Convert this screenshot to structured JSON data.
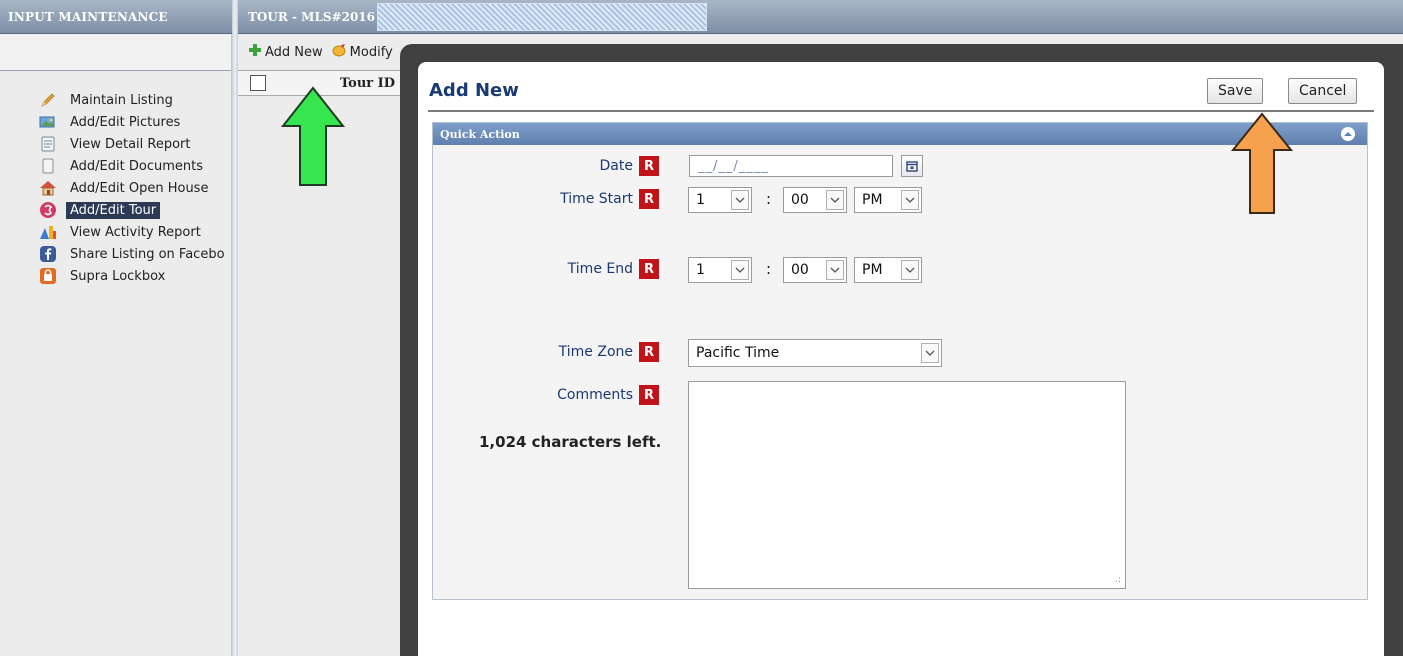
{
  "header": {
    "left_title": "INPUT MAINTENANCE",
    "right_title": "TOUR - MLS#2016"
  },
  "sidebar": {
    "items": [
      {
        "label": "Maintain Listing",
        "icon": "pencil-icon"
      },
      {
        "label": "Add/Edit Pictures",
        "icon": "pictures-icon"
      },
      {
        "label": "View Detail Report",
        "icon": "report-icon"
      },
      {
        "label": "Add/Edit Documents",
        "icon": "documents-icon"
      },
      {
        "label": "Add/Edit Open House",
        "icon": "house-icon"
      },
      {
        "label": "Add/Edit Tour",
        "icon": "tour-icon",
        "active": true
      },
      {
        "label": "View Activity Report",
        "icon": "activity-chart-icon"
      },
      {
        "label": "Share Listing on Facebo",
        "icon": "facebook-icon"
      },
      {
        "label": "Supra Lockbox",
        "icon": "lockbox-icon"
      }
    ]
  },
  "toolbar": {
    "add_new_label": "Add New",
    "modify_label": "Modify"
  },
  "list": {
    "col_tour_id": "Tour ID"
  },
  "modal": {
    "title": "Add New",
    "save_label": "Save",
    "cancel_label": "Cancel",
    "section_title": "Quick Action",
    "required_marker": "R",
    "fields": {
      "date_label": "Date",
      "date_placeholder": "__/__/____",
      "time_start_label": "Time Start",
      "time_start_hour": "1",
      "time_start_minute": "00",
      "time_start_ampm": "PM",
      "time_end_label": "Time End",
      "time_end_hour": "1",
      "time_end_minute": "00",
      "time_end_ampm": "PM",
      "time_zone_label": "Time Zone",
      "time_zone_value": "Pacific Time",
      "comments_label": "Comments",
      "chars_left": "1,024 characters left.",
      "colon": ":"
    }
  },
  "annotations": {
    "green_arrow_color": "#2ee84a",
    "orange_arrow_color": "#f5a14e"
  }
}
